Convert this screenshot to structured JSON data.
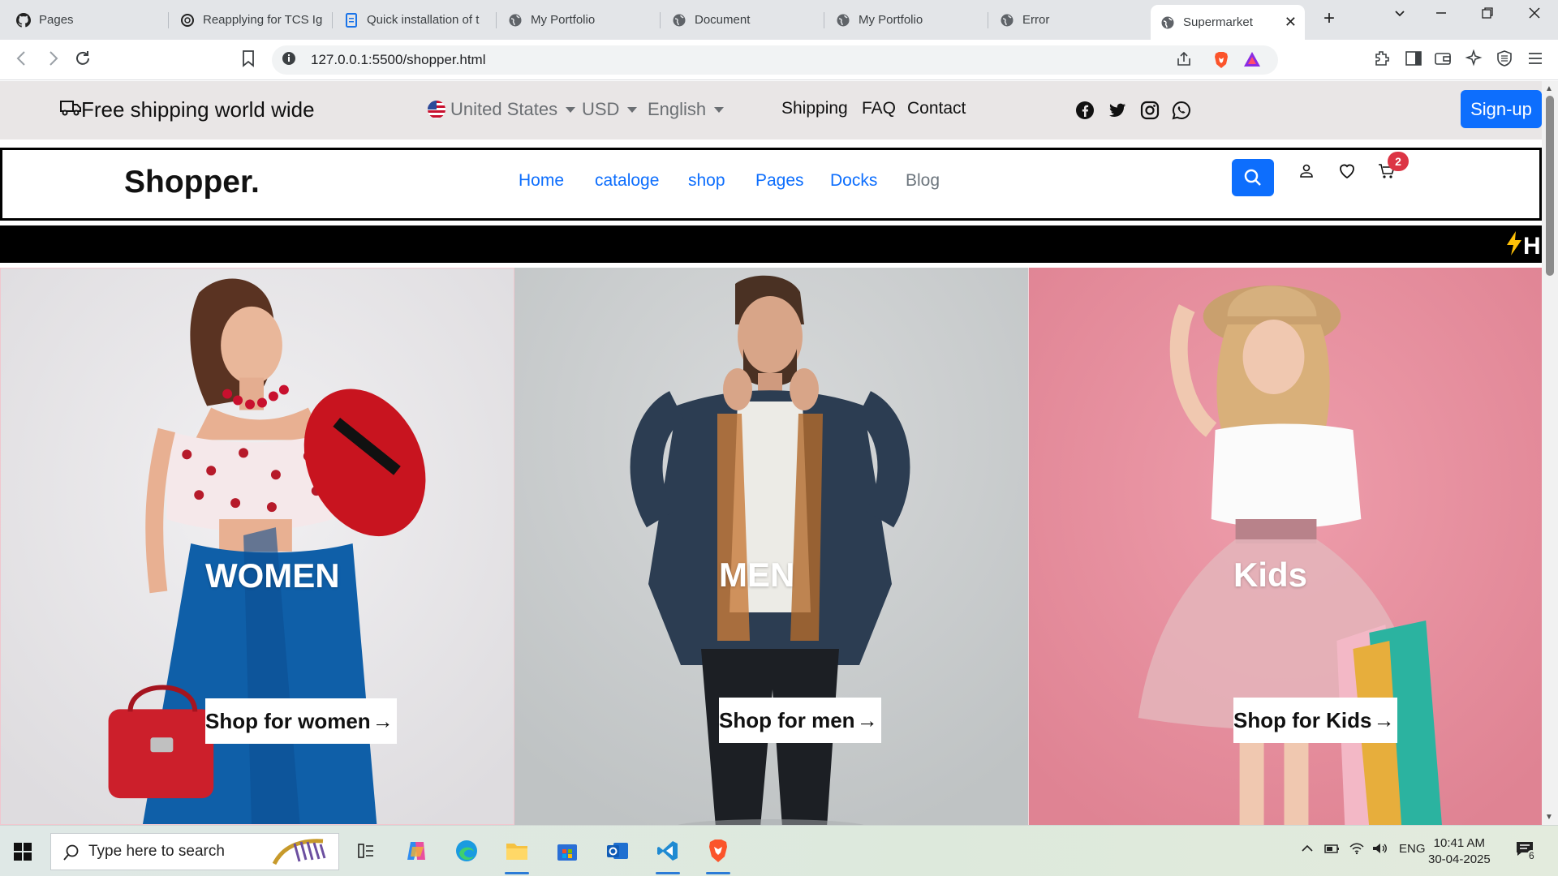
{
  "browser": {
    "tabs": [
      {
        "title": "Pages",
        "icon": "github-icon"
      },
      {
        "title": "Reapplying for TCS Ig",
        "icon": "chatgpt-icon"
      },
      {
        "title": "Quick installation of t",
        "icon": "docs-icon"
      },
      {
        "title": "My Portfolio",
        "icon": "globe-icon"
      },
      {
        "title": "Document",
        "icon": "globe-icon"
      },
      {
        "title": "My Portfolio",
        "icon": "globe-icon"
      },
      {
        "title": "Error",
        "icon": "globe-icon"
      },
      {
        "title": "Supermarket",
        "icon": "globe-icon",
        "active": true
      }
    ],
    "url": "127.0.0.1:5500/shopper.html"
  },
  "topbar": {
    "shipping_text": "Free shipping world wide",
    "country": "United States",
    "currency": "USD",
    "language": "English",
    "links": [
      "Shipping",
      "FAQ",
      "Contact"
    ],
    "social_icons": [
      "facebook-icon",
      "twitter-icon",
      "instagram-icon",
      "whatsapp-icon"
    ],
    "signup_label": "Sign-up"
  },
  "nav": {
    "brand": "Shopper.",
    "links": [
      "Home",
      "cataloge",
      "shop",
      "Pages",
      "Docks",
      "Blog"
    ],
    "cart_count": "2"
  },
  "marquee": {
    "text": "H"
  },
  "hero": [
    {
      "title": "WOMEN",
      "cta": "Shop for women",
      "bg": "#e7e6e8"
    },
    {
      "title": "MEN",
      "cta": "Shop for men",
      "bg": "#c9cccd"
    },
    {
      "title": "Kids",
      "cta": "Shop for Kids",
      "bg": "#e8919f"
    }
  ],
  "colors": {
    "primary": "#0d6efd",
    "badge": "#dc3545",
    "topbar_bg": "#e9e6e6"
  },
  "taskbar": {
    "search_placeholder": "Type here to search",
    "language": "ENG",
    "time": "10:41 AM",
    "date": "30-04-2025",
    "notifications": "6"
  }
}
